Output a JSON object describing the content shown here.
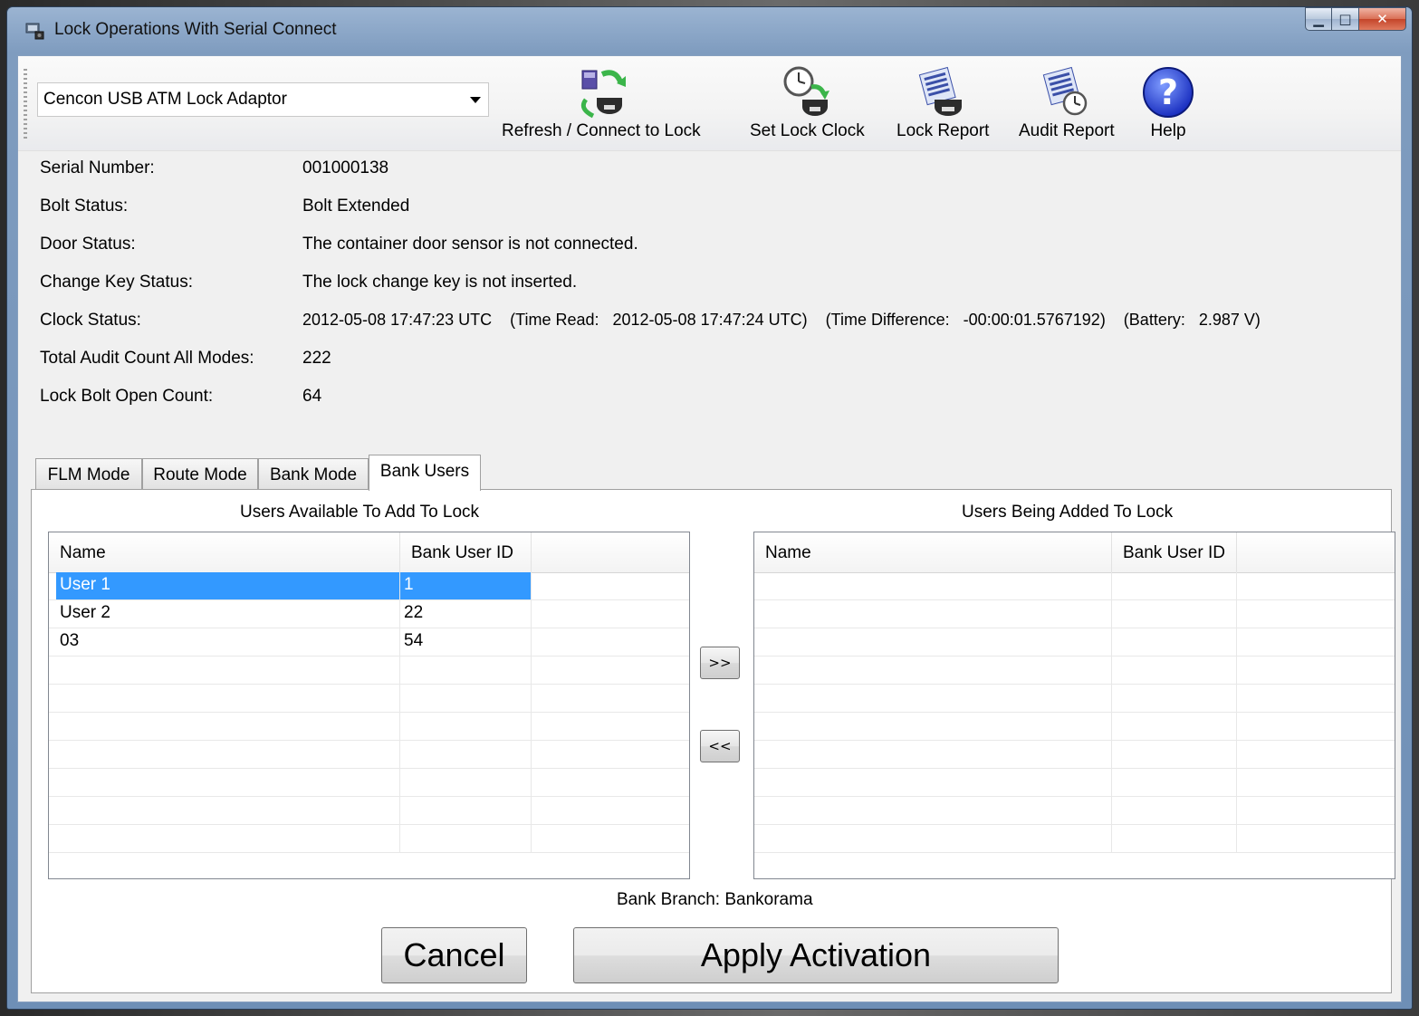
{
  "window": {
    "title": "Lock Operations With Serial Connect"
  },
  "toolbar": {
    "adapter_select": {
      "value": "Cencon USB ATM Lock Adaptor"
    },
    "buttons": [
      {
        "label": "Refresh / Connect to Lock",
        "icon": "refresh-connect-icon"
      },
      {
        "label": "Set Lock Clock",
        "icon": "clock-icon"
      },
      {
        "label": "Lock Report",
        "icon": "lock-report-icon"
      },
      {
        "label": "Audit Report",
        "icon": "audit-report-icon"
      },
      {
        "label": "Help",
        "icon": "help-icon"
      }
    ]
  },
  "info": {
    "serial_number": {
      "label": "Serial Number:",
      "value": "001000138"
    },
    "bolt_status": {
      "label": "Bolt Status:",
      "value": "Bolt Extended"
    },
    "door_status": {
      "label": "Door Status:",
      "value": "The container door sensor is not connected."
    },
    "change_key_status": {
      "label": "Change Key Status:",
      "value": "The lock change key is not inserted."
    },
    "clock_status": {
      "label": "Clock Status:",
      "value": "2012-05-08 17:47:23 UTC    (Time Read:   2012-05-08 17:47:24 UTC)    (Time Difference:   -00:00:01.5767192)    (Battery:   2.987 V)"
    },
    "total_audit_count": {
      "label": "Total Audit Count All Modes:",
      "value": "222"
    },
    "bolt_open_count": {
      "label": "Lock Bolt Open Count:",
      "value": "64"
    }
  },
  "tabs": [
    {
      "label": "FLM Mode",
      "active": false
    },
    {
      "label": "Route Mode",
      "active": false
    },
    {
      "label": "Bank Mode",
      "active": false
    },
    {
      "label": "Bank Users",
      "active": true
    }
  ],
  "bank_users": {
    "available_caption": "Users Available To Add To Lock",
    "adding_caption": "Users Being Added To Lock",
    "columns": [
      "Name",
      "Bank User ID"
    ],
    "available_rows": [
      {
        "name": "User 1",
        "id": "1",
        "selected": true
      },
      {
        "name": "User 2",
        "id": "22",
        "selected": false
      },
      {
        "name": "03",
        "id": "54",
        "selected": false
      }
    ],
    "adding_rows": [],
    "add_button": ">>",
    "remove_button": "<<",
    "branch_label": "Bank Branch:",
    "branch_value": "Bankorama"
  },
  "actions": {
    "cancel": "Cancel",
    "apply": "Apply Activation"
  },
  "colors": {
    "selection": "#3399ff",
    "help_blue": "#1a3fd6"
  }
}
